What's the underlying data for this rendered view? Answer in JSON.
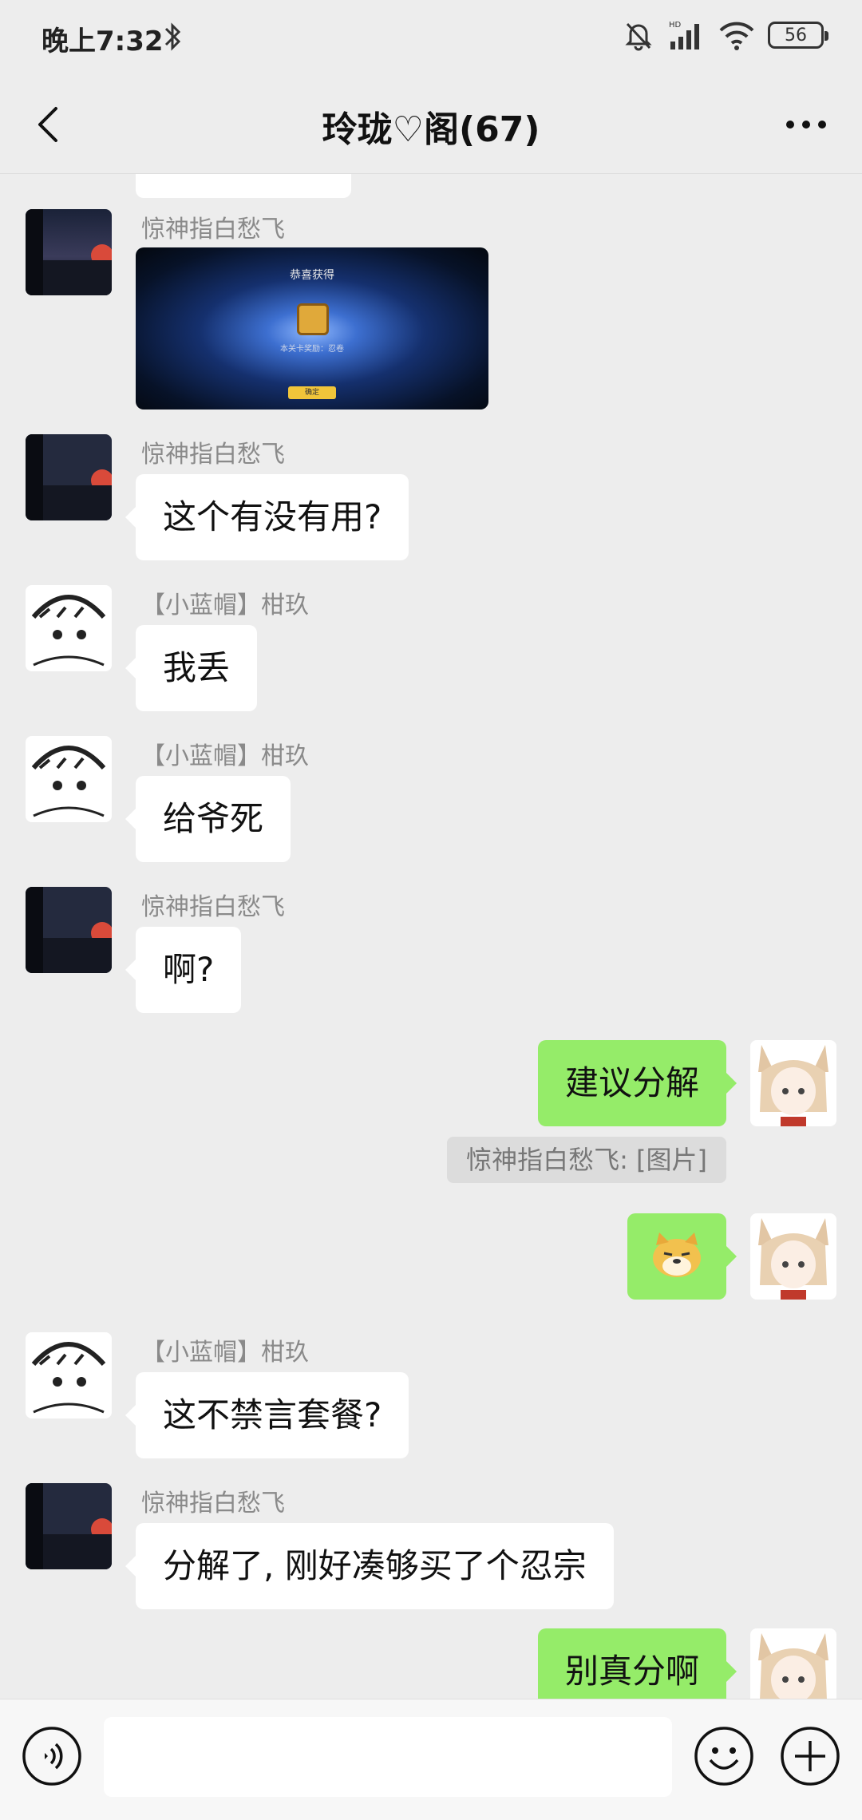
{
  "status": {
    "time": "晚上7:32",
    "battery": "56",
    "network": "HD"
  },
  "header": {
    "title": "玲珑♡阁(67)"
  },
  "messages": [
    {
      "sender": "惊神指白愁飞",
      "type": "image",
      "image_title": "恭喜获得",
      "image_sub": "本关卡奖励：忍卷",
      "image_button": "确定"
    },
    {
      "sender": "惊神指白愁飞",
      "text": "这个有没有用?"
    },
    {
      "sender": "【小蓝帽】柑玖",
      "text": "我丢"
    },
    {
      "sender": "【小蓝帽】柑玖",
      "text": "给爷死"
    },
    {
      "sender": "惊神指白愁飞",
      "text": "啊?"
    },
    {
      "sender": "me",
      "text": "建议分解"
    },
    {
      "sender": "notice",
      "text": "惊神指白愁飞: [图片]"
    },
    {
      "sender": "me",
      "type": "emoji",
      "emoji": "doge-emoji"
    },
    {
      "sender": "【小蓝帽】柑玖",
      "text": "这不禁言套餐?"
    },
    {
      "sender": "惊神指白愁飞",
      "text": "分解了, 刚好凑够买了个忍宗"
    },
    {
      "sender": "me",
      "text": "别真分啊"
    }
  ],
  "icons": [
    "back-arrow-icon",
    "more-icon",
    "bluetooth-icon",
    "mute-bell-icon",
    "signal-icon",
    "wifi-icon",
    "voice-icon",
    "emoji-icon",
    "plus-icon"
  ],
  "colors": {
    "background": "#ededed",
    "bubble_in": "#ffffff",
    "bubble_out": "#95ec69",
    "notice_bg": "#dcdcdc"
  }
}
